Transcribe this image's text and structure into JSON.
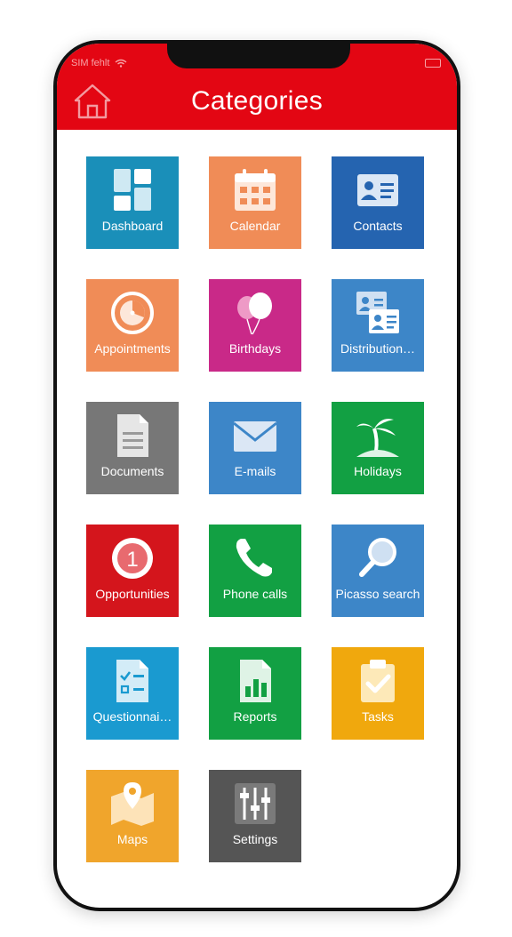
{
  "status": {
    "carrier": "SIM fehlt"
  },
  "header": {
    "title": "Categories",
    "home_icon": "home-icon",
    "color": "#e30613"
  },
  "tiles": [
    {
      "label": "Dashboard",
      "icon": "dashboard-icon",
      "color": "#1a8fb9"
    },
    {
      "label": "Calendar",
      "icon": "calendar-icon",
      "color": "#f08c57"
    },
    {
      "label": "Contacts",
      "icon": "contact-card-icon",
      "color": "#2564b0"
    },
    {
      "label": "Appointments",
      "icon": "appointment-clock-icon",
      "color": "#f08c57"
    },
    {
      "label": "Birthdays",
      "icon": "balloons-icon",
      "color": "#c92988"
    },
    {
      "label": "Distribution…",
      "icon": "distribution-cards-icon",
      "color": "#3d86c8"
    },
    {
      "label": "Documents",
      "icon": "document-icon",
      "color": "#777777"
    },
    {
      "label": "E-mails",
      "icon": "envelope-icon",
      "color": "#3d86c8"
    },
    {
      "label": "Holidays",
      "icon": "palm-island-icon",
      "color": "#12a043"
    },
    {
      "label": "Opportunities",
      "icon": "opportunity-badge-icon",
      "color": "#d4151c"
    },
    {
      "label": "Phone calls",
      "icon": "phone-icon",
      "color": "#12a043"
    },
    {
      "label": "Picasso search",
      "icon": "magnifier-icon",
      "color": "#3d86c8"
    },
    {
      "label": "Questionnai…",
      "icon": "questionnaire-icon",
      "color": "#1a9ad0"
    },
    {
      "label": "Reports",
      "icon": "report-chart-icon",
      "color": "#12a043"
    },
    {
      "label": "Tasks",
      "icon": "clipboard-check-icon",
      "color": "#f0a80d"
    },
    {
      "label": "Maps",
      "icon": "map-pin-icon",
      "color": "#f0a52c"
    },
    {
      "label": "Settings",
      "icon": "sliders-icon",
      "color": "#555555"
    }
  ]
}
